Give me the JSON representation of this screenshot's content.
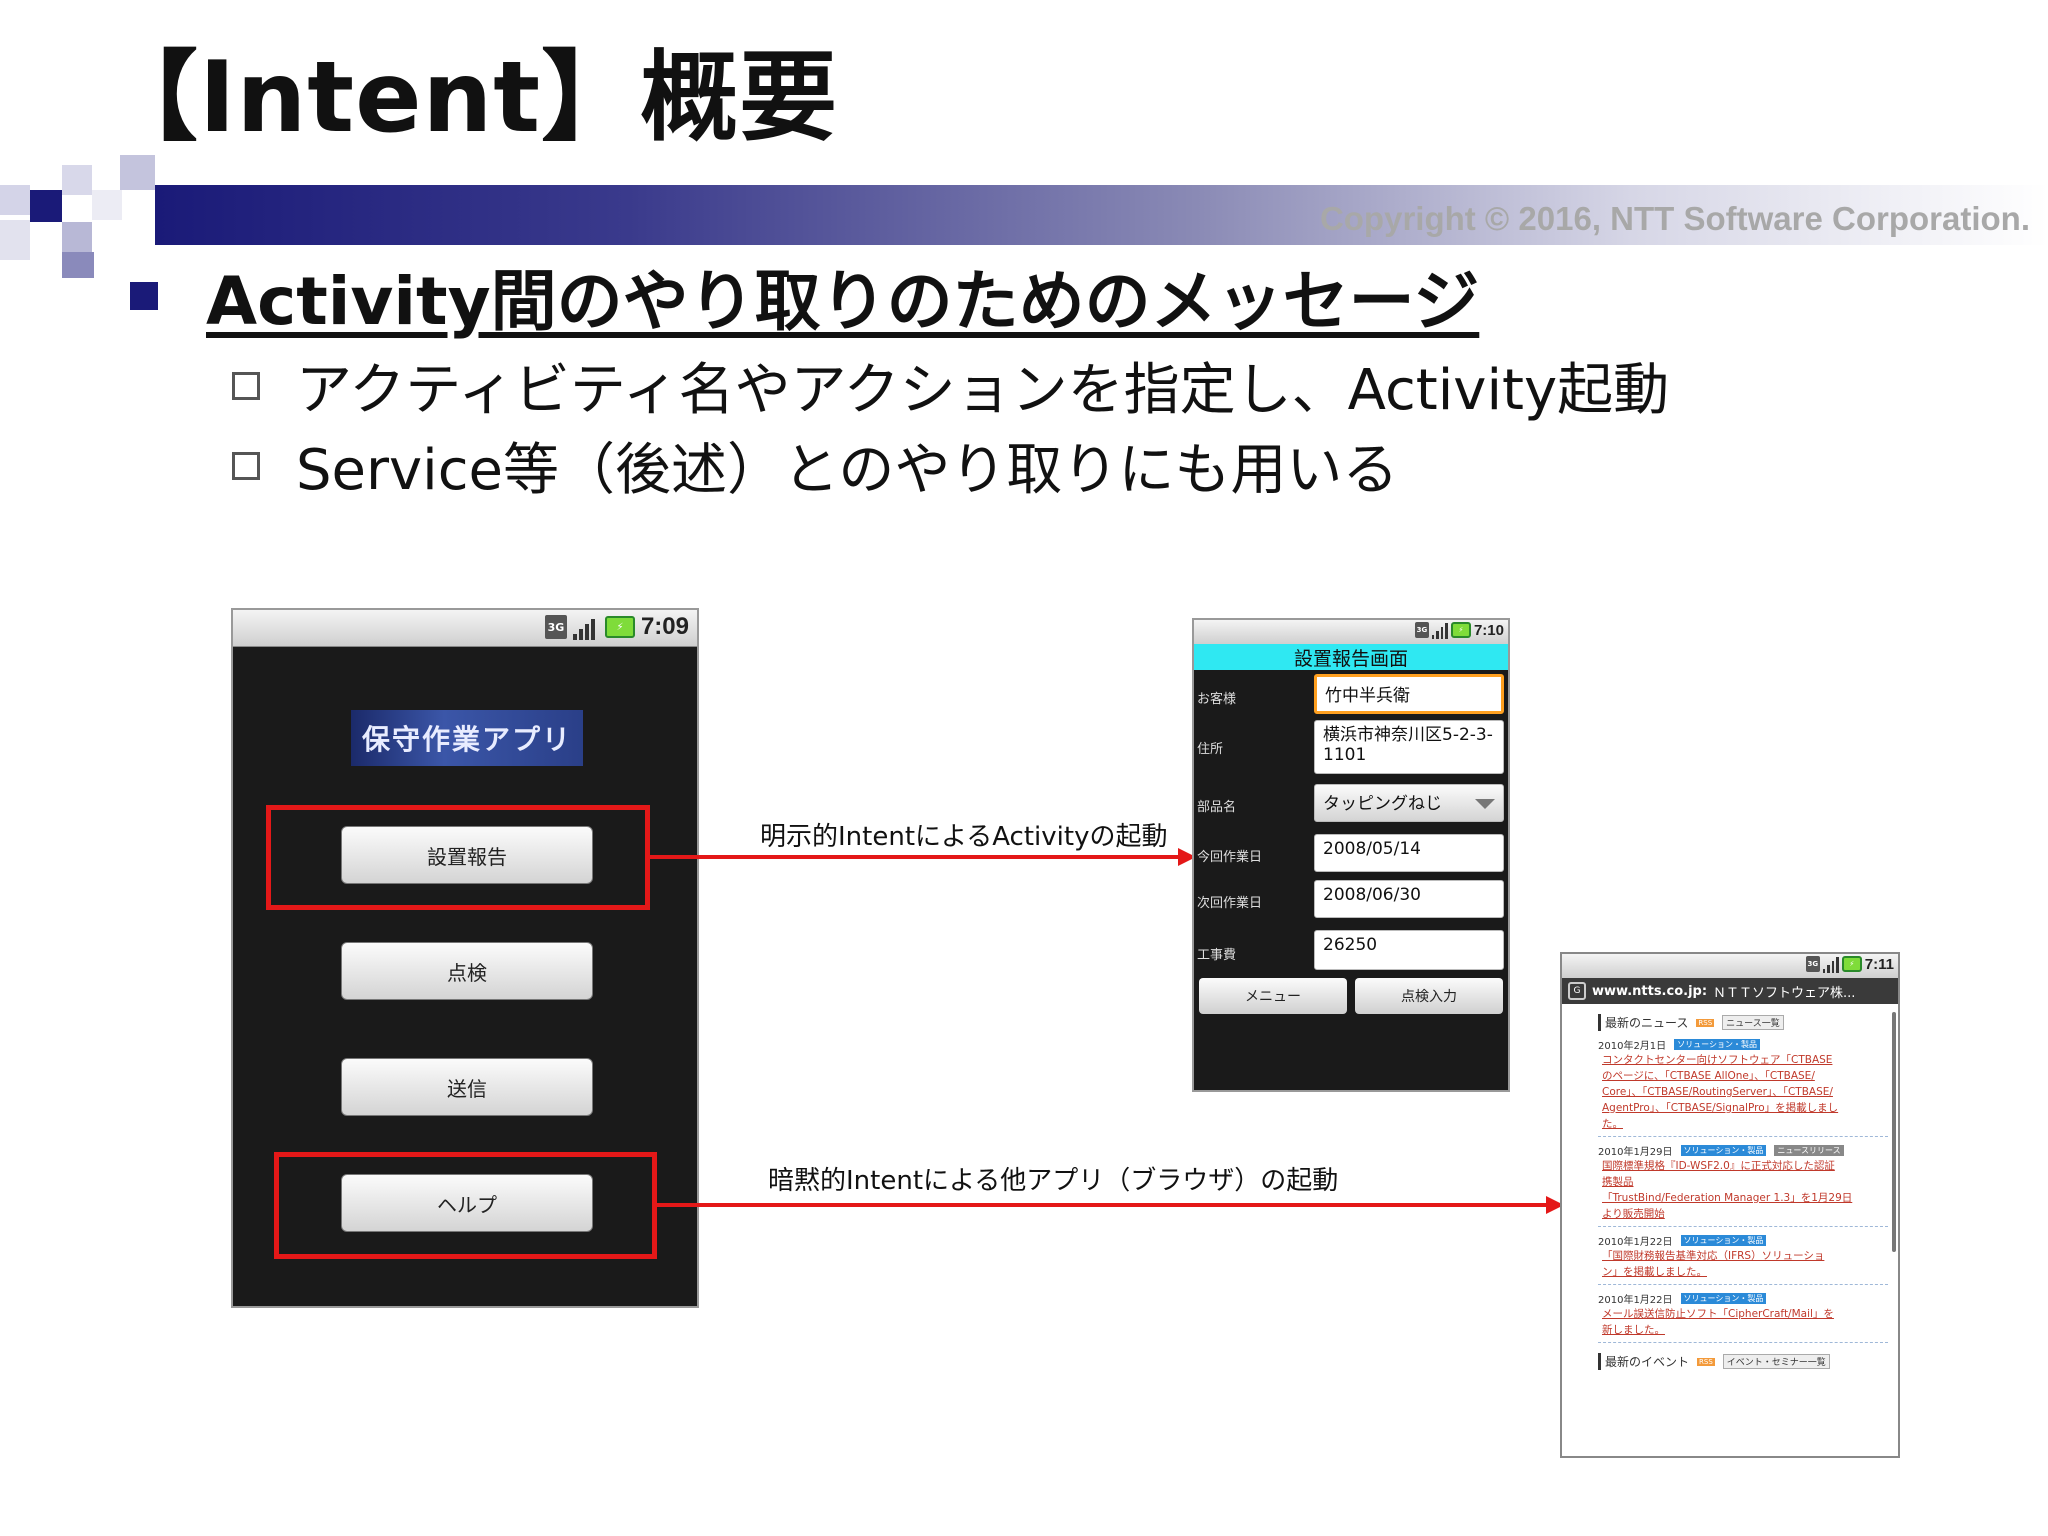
{
  "slide": {
    "title": "【Intent】概要",
    "copyright": "Copyright © 2016, NTT Software Corporation.",
    "bullet_main": "Activity間のやり取りのためのメッセージ",
    "bullets_sub": [
      "アクティビティ名やアクションを指定し、Activity起動",
      "Service等（後述）とのやり取りにも用いる"
    ]
  },
  "colors": {
    "accent": "#1a1a78",
    "highlight": "#e41818",
    "form_header": "#2fe8f2"
  },
  "arrows": {
    "explicit_label": "明示的IntentによるActivityの起動",
    "implicit_label": "暗黙的Intentによる他アプリ（ブラウザ）の起動"
  },
  "phone1": {
    "time": "7:09",
    "app_title": "保守作業アプリ",
    "buttons": [
      "設置報告",
      "点検",
      "送信",
      "ヘルプ"
    ]
  },
  "phone2": {
    "time": "7:10",
    "screen_title": "設置報告画面",
    "fields": [
      {
        "label": "お客様",
        "value": "竹中半兵衛"
      },
      {
        "label": "住所",
        "value": "横浜市神奈川区5-2-3-1101"
      },
      {
        "label": "部品名",
        "value": "タッピングねじ"
      },
      {
        "label": "今回作業日",
        "value": "2008/05/14"
      },
      {
        "label": "次回作業日",
        "value": "2008/06/30"
      },
      {
        "label": "工事費",
        "value": "26250"
      }
    ],
    "buttons": [
      "メニュー",
      "点検入力"
    ]
  },
  "phone3": {
    "time": "7:11",
    "url_domain": "www.ntts.co.jp:",
    "url_title": "ＮＴＴソフトウェア株...",
    "news_heading": "最新のニュース",
    "news_list_button": "ニュース一覧",
    "rss": "RSS",
    "news": [
      {
        "date": "2010年2月1日",
        "tag": "ソリューション・製品",
        "tag2": "",
        "lines": [
          "コンタクトセンター向けソフトウェア「CTBASE",
          "のページに、「CTBASE AllOne」、「CTBASE/",
          "Core」、「CTBASE/RoutingServer」、「CTBASE/",
          "AgentPro」、「CTBASE/SignalPro」を掲載しまし",
          "た。"
        ]
      },
      {
        "date": "2010年1月29日",
        "tag": "ソリューション・製品",
        "tag2": "ニュースリリース",
        "lines": [
          "国際標準規格『ID-WSF2.0』に正式対応した認証",
          "携製品",
          "「TrustBind/Federation Manager 1.3」を1月29日",
          "より販売開始"
        ]
      },
      {
        "date": "2010年1月22日",
        "tag": "ソリューション・製品",
        "tag2": "",
        "lines": [
          "「国際財務報告基準対応（IFRS）ソリューショ",
          "ン」を掲載しました。"
        ]
      },
      {
        "date": "2010年1月22日",
        "tag": "ソリューション・製品",
        "tag2": "",
        "lines": [
          "メール誤送信防止ソフト「CipherCraft/Mail」を",
          "新しました。"
        ]
      }
    ],
    "events_heading": "最新のイベント",
    "events_list_button": "イベント・セミナー一覧"
  }
}
